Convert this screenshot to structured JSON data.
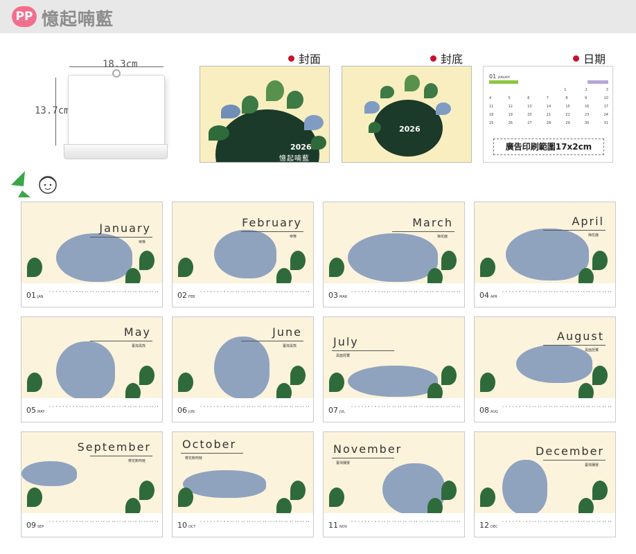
{
  "header": {
    "badge": "PP",
    "title": "憶起喃藍"
  },
  "stand": {
    "width_label": "18.3cm",
    "height_label": "13.7cm"
  },
  "previews": {
    "front": {
      "label": "封面",
      "year": "2026",
      "name": "憶起喃藍"
    },
    "back": {
      "label": "封底",
      "year": "2026"
    },
    "date": {
      "label": "日期",
      "month_num": "01",
      "month_name": "JANUARY",
      "ad_text": "廣告印刷範圍17x2cm"
    }
  },
  "months": [
    {
      "name": "January",
      "sub": "帝雉",
      "num": "01",
      "abbr": "JAN"
    },
    {
      "name": "February",
      "sub": "帝雉",
      "num": "02",
      "abbr": "FEB"
    },
    {
      "name": "March",
      "sub": "梅花鹿",
      "num": "03",
      "abbr": "MAR"
    },
    {
      "name": "April",
      "sub": "梅花鹿",
      "num": "04",
      "abbr": "APR"
    },
    {
      "name": "May",
      "sub": "臺灣黑熊",
      "num": "05",
      "abbr": "MAY"
    },
    {
      "name": "June",
      "sub": "臺灣黑熊",
      "num": "06",
      "abbr": "JUN"
    },
    {
      "name": "July",
      "sub": "黑面琵鷺",
      "num": "07",
      "abbr": "JUL"
    },
    {
      "name": "August",
      "sub": "黑面琵鷺",
      "num": "08",
      "abbr": "AUG"
    },
    {
      "name": "September",
      "sub": "櫻花鉤吻鮭",
      "num": "09",
      "abbr": "SEP"
    },
    {
      "name": "October",
      "sub": "櫻花鉤吻鮭",
      "num": "10",
      "abbr": "OCT"
    },
    {
      "name": "November",
      "sub": "臺灣獼猴",
      "num": "11",
      "abbr": "NOV"
    },
    {
      "name": "December",
      "sub": "臺灣獼猴",
      "num": "12",
      "abbr": "DEC"
    }
  ],
  "days_row": "1 2 3 4 5 6 7 8 9 10 11 12 13 14 15 16 17 18 19 20 21 22 23 24 25 26 27 28 29 30 31",
  "colors": {
    "card_bg": "#fcf3dc",
    "badge": "#f16f8d",
    "accent_red": "#c8102e",
    "leaf_green": "#2f6b3a",
    "animal_blue": "#8fa3bf"
  }
}
